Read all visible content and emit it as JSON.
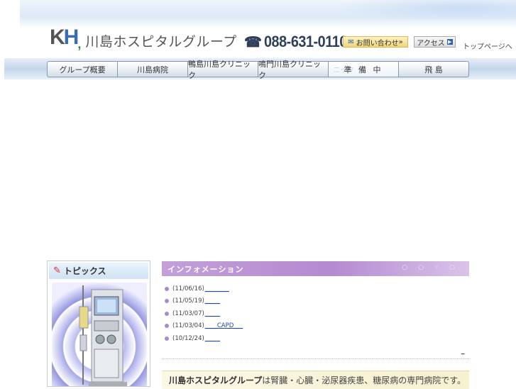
{
  "header": {
    "logo_mark": "KH",
    "group_name": "川島ホスピタルグループ",
    "phone_number": "088-631-0110",
    "contact_label": "お問い合わせ",
    "access_label": "アクセス",
    "top_link": "トップページへ"
  },
  "nav": {
    "items": [
      {
        "label": "グループ概要"
      },
      {
        "label": "川島病院"
      },
      {
        "label": "鴨島川島クリニック"
      },
      {
        "label": "鳴門川島クリニック"
      },
      {
        "label": "準 備 中",
        "ghost": "ニック"
      },
      {
        "label": "飛 島"
      }
    ]
  },
  "topics": {
    "heading": "トピックス"
  },
  "information": {
    "heading": "インフォメーション",
    "items": [
      {
        "date": "(11/06/16)",
        "link": "________"
      },
      {
        "date": "(11/05/19)",
        "link": "_____"
      },
      {
        "date": "(11/03/07)",
        "link": "_____"
      },
      {
        "date": "(11/03/04)",
        "link": "____CAPD___"
      },
      {
        "date": "(10/12/24)",
        "link": "_____"
      }
    ],
    "more_link": "_"
  },
  "banner": {
    "name": "川島ホスピタルグループ",
    "text": "は腎臓・心臓・泌尿器疾患、糖尿病の専門病院です。"
  },
  "colors": {
    "nav_border": "#8a99aa",
    "info_header": "#b48ad0",
    "bullet": "#a98cc9",
    "link": "#2244aa"
  }
}
